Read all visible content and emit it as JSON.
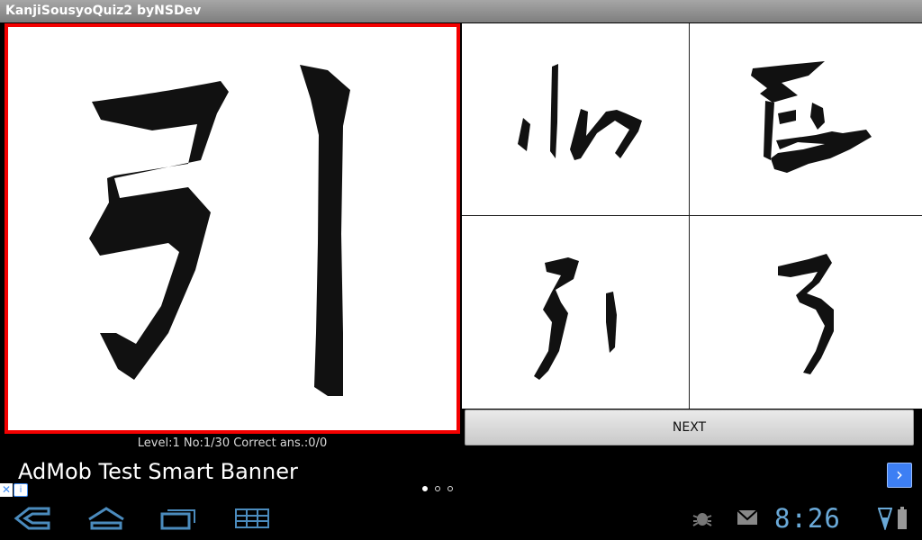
{
  "app": {
    "title": "KanjiSousyoQuiz2 byNSDev"
  },
  "quiz": {
    "kanji": "引",
    "status": "Level:1 No:1/30 Correct ans.:0/0",
    "next_label": "NEXT",
    "choices": [
      {
        "id": "choice-1"
      },
      {
        "id": "choice-2"
      },
      {
        "id": "choice-3"
      },
      {
        "id": "choice-4"
      }
    ]
  },
  "ad": {
    "title": "AdMob Test Smart Banner",
    "arrow": "›",
    "close": "✕",
    "info": "i",
    "pager": {
      "count": 3,
      "active": 0
    }
  },
  "system": {
    "clock": "8:26",
    "icons": [
      "back-icon",
      "home-icon",
      "recent-apps-icon",
      "screenshot-icon",
      "debug-icon",
      "gmail-icon",
      "signal-icon",
      "battery-icon"
    ]
  },
  "colors": {
    "selection_border": "#f40000",
    "clock": "#6aa9d8",
    "ad_button": "#3d7ff4"
  }
}
